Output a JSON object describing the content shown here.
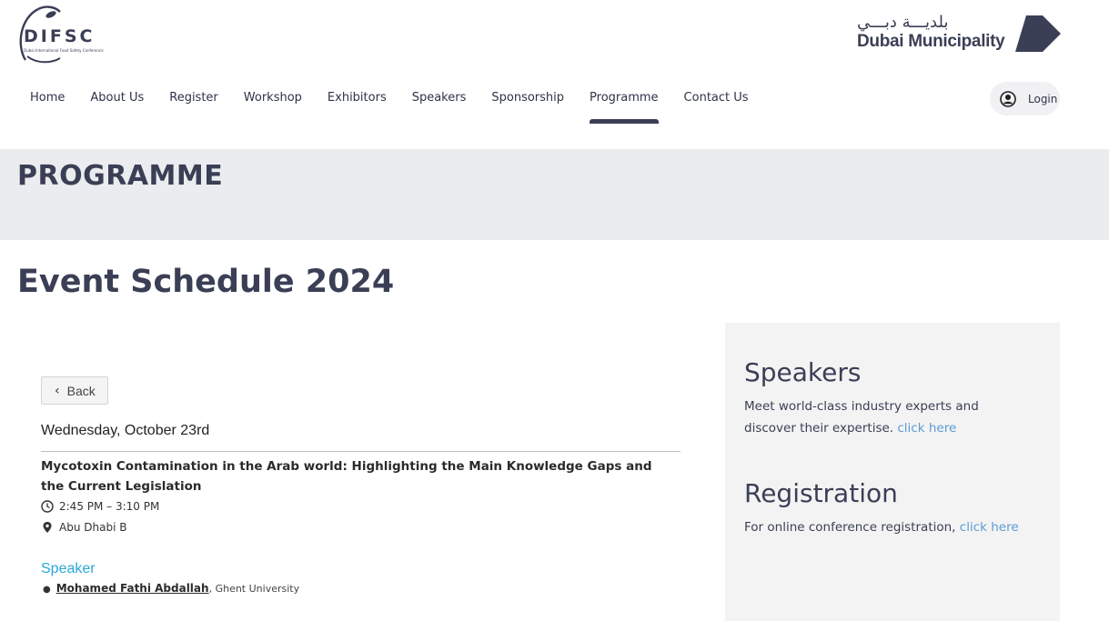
{
  "header": {
    "logo_left": {
      "wordmark": "DIFSC",
      "subtitle": "Dubai International Food Safety Conference"
    },
    "logo_right": {
      "arabic": "بلديـــة دبـــي",
      "english": "Dubai Municipality"
    },
    "nav": [
      {
        "label": "Home"
      },
      {
        "label": "About Us"
      },
      {
        "label": "Register"
      },
      {
        "label": "Workshop"
      },
      {
        "label": "Exhibitors"
      },
      {
        "label": "Speakers"
      },
      {
        "label": "Sponsorship"
      },
      {
        "label": "Programme",
        "active": true
      },
      {
        "label": "Contact Us"
      }
    ],
    "login_label": "Login",
    "login_icon": "user-circle-icon"
  },
  "banner": {
    "title": "PROGRAMME"
  },
  "page": {
    "schedule_title": "Event Schedule 2024"
  },
  "session": {
    "back_label": "Back",
    "date": "Wednesday, October 23rd",
    "title": "Mycotoxin Contamination in the Arab world: Highlighting the Main Knowledge Gaps and the Current Legislation",
    "time": "2:45 PM – 3:10 PM",
    "location": "Abu Dhabi B",
    "speaker_heading": "Speaker",
    "speakers": [
      {
        "name": "Mohamed Fathi Abdallah",
        "affiliation": ", Ghent University"
      }
    ]
  },
  "sidebar": {
    "speakers": {
      "title": "Speakers",
      "text_line1": "Meet world-class industry experts and",
      "text_line2": "discover their expertise.",
      "link": "click here"
    },
    "registration": {
      "title": "Registration",
      "text": "For online conference registration,",
      "link": "click here"
    }
  },
  "colors": {
    "primary": "#3a3f55",
    "banner_bg": "#ebecef",
    "link": "#5b9bd5",
    "speaker_heading": "#29a8d9",
    "sidebar_bg": "#f3f3f3"
  }
}
